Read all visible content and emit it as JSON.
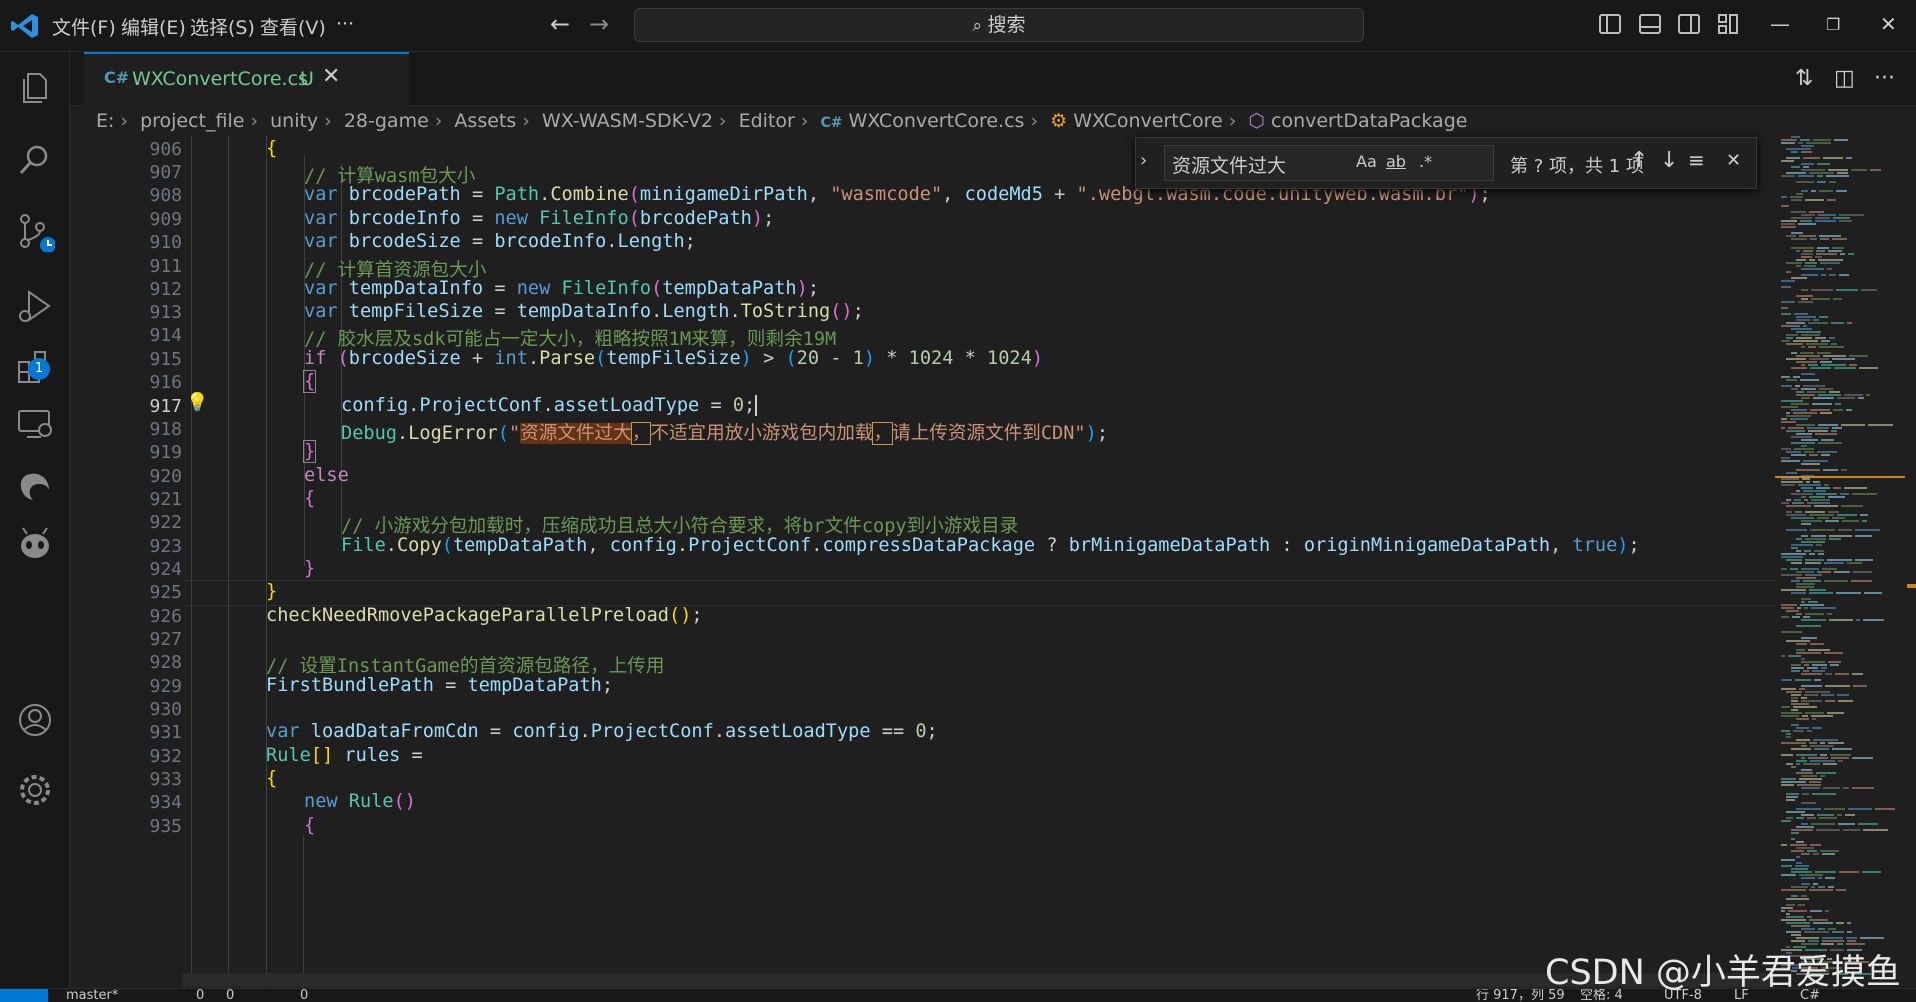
{
  "titlebar": {
    "menus": [
      "文件(F)",
      "编辑(E)",
      "选择(S)",
      "查看(V)",
      "···"
    ],
    "search_placeholder": "搜索",
    "icons": [
      "vscode-logo-icon",
      "back-arrow-icon",
      "forward-arrow-icon",
      "search-icon",
      "toggle-primary-sidebar-icon",
      "toggle-panel-icon",
      "toggle-secondary-sidebar-icon",
      "customize-layout-icon",
      "minimize-icon",
      "restore-icon",
      "close-icon"
    ]
  },
  "activitybar": {
    "items": [
      "explorer-icon",
      "search-icon",
      "source-control-icon",
      "run-debug-icon",
      "extensions-icon",
      "remote-explorer-icon",
      "edge-devtools-icon",
      "copilot-icon"
    ],
    "extensions_badge": "1",
    "bottom": [
      "accounts-icon",
      "settings-gear-icon"
    ]
  },
  "tab": {
    "icon_text": "C#",
    "filename": "WXConvertCore.cs",
    "status": "U",
    "close": "✕"
  },
  "breadcrumb": [
    "E:",
    "project_file",
    "unity",
    "28-game",
    "Assets",
    "WX-WASM-SDK-V2",
    "Editor",
    "WXConvertCore.cs",
    "WXConvertCore",
    "convertDataPackage"
  ],
  "find": {
    "value": "资源文件过大",
    "match_case": "Aa",
    "whole_word": "ab",
    "regex": ".*",
    "result": "第 ? 项，共 1 项"
  },
  "editor": {
    "line_numbers": [
      "906",
      "907",
      "908",
      "909",
      "910",
      "911",
      "912",
      "913",
      "914",
      "915",
      "916",
      "917",
      "918",
      "919",
      "920",
      "921",
      "922",
      "923",
      "924",
      "925",
      "926",
      "927",
      "928",
      "929",
      "930",
      "931",
      "932",
      "933",
      "934",
      "935"
    ],
    "current_line": "917",
    "comments": {
      "c907": "// 计算wasm包大小",
      "c911": "// 计算首资源包大小",
      "c914": "// 胶水层及sdk可能占一定大小，粗略按照1M来算，则剩余19M",
      "c922": "// 小游戏分包加载时，压缩成功且总大小符合要求，将br文件copy到小游戏目录",
      "c928": "// 设置InstantGame的首资源包路径，上传用"
    },
    "strings": {
      "s908a": "\"wasmcode\"",
      "s908b": "\".webgl.wasm.code.unityweb.wasm.br\"",
      "s918_open": "\"",
      "s918_match": "资源文件过大",
      "s918_c1": "，",
      "s918_mid": "不适宜用放小游戏包内加载",
      "s918_c2": "，",
      "s918_end": "请上传资源文件到CDN\""
    },
    "numbers": [
      "20",
      "1",
      "1024",
      "1024",
      "0",
      "0"
    ],
    "keywords": {
      "var": "var",
      "new": "new",
      "if": "if",
      "else": "else",
      "true": "true",
      "int": "int"
    }
  },
  "statusbar": {
    "branch": "master*",
    "errors": "0",
    "warnings": "0",
    "ports": "0",
    "cursor": "行 917，列 59",
    "indent": "空格: 4",
    "encoding": "UTF-8",
    "eol": "LF",
    "language": "C#"
  },
  "watermark": "CSDN @小羊君爱摸鱼",
  "colors": {
    "accent": "#0078d4",
    "untracked_file": "#73c991",
    "find_highlight": "#623315"
  }
}
